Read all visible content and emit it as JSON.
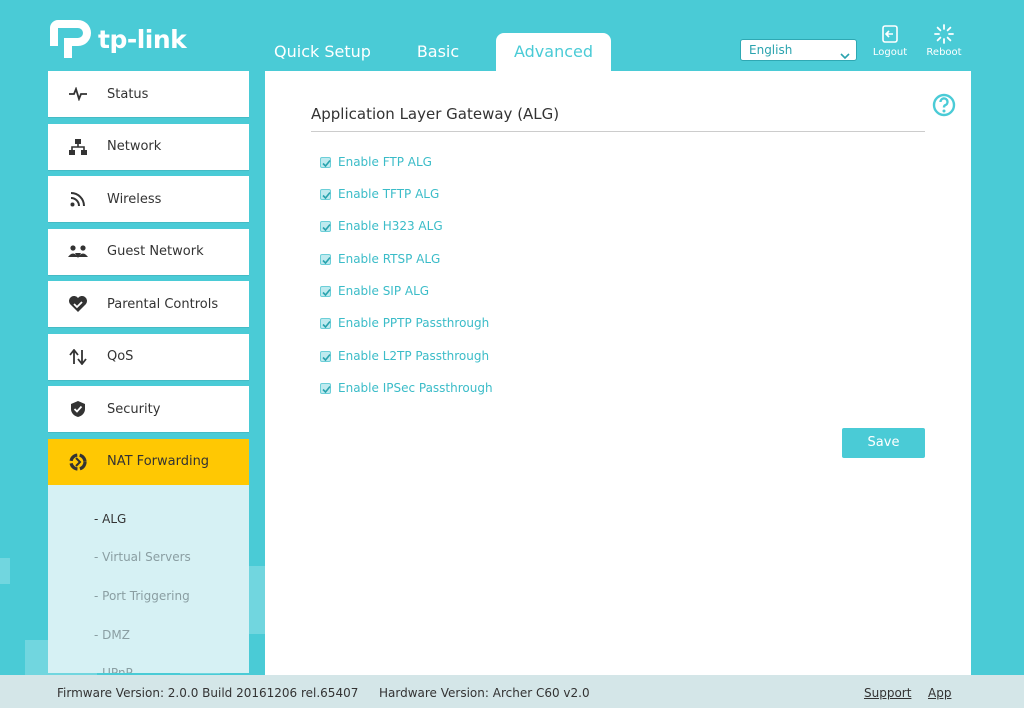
{
  "brand": {
    "logo_text": "tp-link"
  },
  "tabs": [
    {
      "label": "Quick Setup",
      "active": false
    },
    {
      "label": "Basic",
      "active": false
    },
    {
      "label": "Advanced",
      "active": true
    }
  ],
  "language": {
    "selected": "English"
  },
  "header_buttons": {
    "logout": "Logout",
    "reboot": "Reboot"
  },
  "sidebar": {
    "items": [
      {
        "label": "Status",
        "icon": "pulse-icon"
      },
      {
        "label": "Network",
        "icon": "network-icon"
      },
      {
        "label": "Wireless",
        "icon": "wifi-icon"
      },
      {
        "label": "Guest Network",
        "icon": "guest-icon"
      },
      {
        "label": "Parental Controls",
        "icon": "heart-icon"
      },
      {
        "label": "QoS",
        "icon": "updown-arrows-icon"
      },
      {
        "label": "Security",
        "icon": "shield-icon"
      },
      {
        "label": "NAT Forwarding",
        "icon": "nat-icon",
        "active": true
      }
    ],
    "subitems": [
      {
        "label": "- ALG",
        "active": true
      },
      {
        "label": "- Virtual Servers"
      },
      {
        "label": "- Port Triggering"
      },
      {
        "label": "- DMZ"
      },
      {
        "label": "- UPnP"
      }
    ]
  },
  "panel": {
    "title": "Application Layer Gateway (ALG)",
    "options": [
      {
        "label": "Enable FTP ALG",
        "checked": true
      },
      {
        "label": "Enable TFTP ALG",
        "checked": true
      },
      {
        "label": "Enable H323 ALG",
        "checked": true
      },
      {
        "label": "Enable RTSP ALG",
        "checked": true
      },
      {
        "label": "Enable SIP ALG",
        "checked": true
      },
      {
        "label": "Enable PPTP Passthrough",
        "checked": true
      },
      {
        "label": "Enable L2TP Passthrough",
        "checked": true
      },
      {
        "label": "Enable IPSec Passthrough",
        "checked": true
      }
    ],
    "save_label": "Save"
  },
  "footer": {
    "firmware": "Firmware Version: 2.0.0 Build 20161206 rel.65407",
    "hardware": "Hardware Version: Archer C60 v2.0",
    "support": "Support",
    "app": "App"
  },
  "colors": {
    "accent": "#4acbd6",
    "active_menu": "#ffc803",
    "footer_bg": "#d4e6e8"
  }
}
